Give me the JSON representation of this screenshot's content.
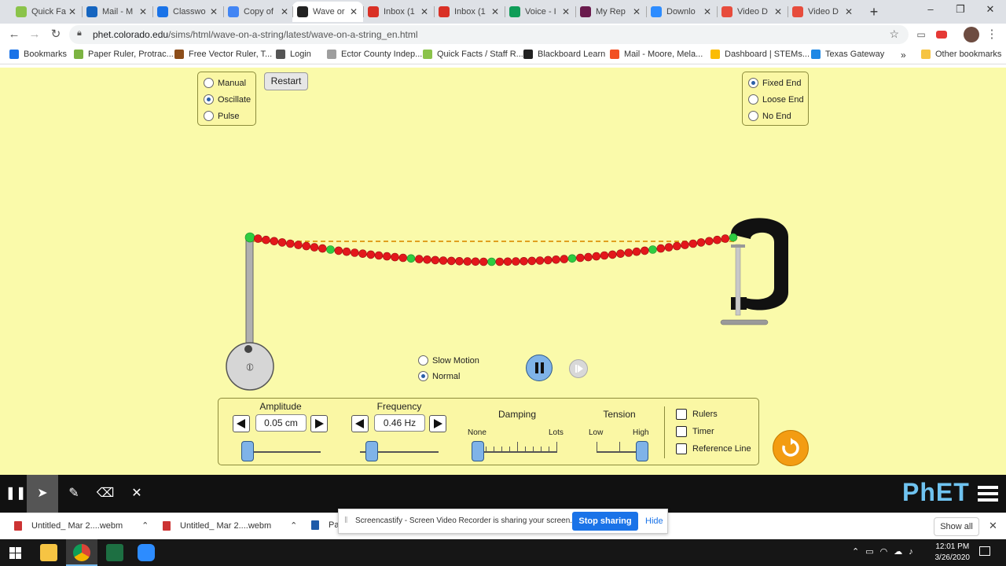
{
  "browser": {
    "tabs": [
      {
        "title": "Quick Fa",
        "color": "#8bc34a"
      },
      {
        "title": "Mail - M",
        "color": "#1565c0"
      },
      {
        "title": "Classwo",
        "color": "#1a73e8"
      },
      {
        "title": "Copy of",
        "color": "#4285f4"
      },
      {
        "title": "Wave or",
        "color": "#222222"
      },
      {
        "title": "Inbox (1",
        "color": "#d93025"
      },
      {
        "title": "Inbox (1",
        "color": "#d93025"
      },
      {
        "title": "Voice - I",
        "color": "#0f9d58"
      },
      {
        "title": "My Rep",
        "color": "#6a1b4d"
      },
      {
        "title": "Downlo",
        "color": "#2d8cff"
      },
      {
        "title": "Video D",
        "color": "#e74c3c"
      },
      {
        "title": "Video D",
        "color": "#e74c3c"
      }
    ],
    "url_host": "phet.colorado.edu",
    "url_path": "/sims/html/wave-on-a-string/latest/wave-on-a-string_en.html",
    "bookmarks": [
      {
        "label": "Bookmarks",
        "color": "#1a73e8"
      },
      {
        "label": "Paper Ruler, Protrac...",
        "color": "#7cb342"
      },
      {
        "label": "Free Vector Ruler, T...",
        "color": "#8d4e1a"
      },
      {
        "label": "Login",
        "color": "#555555"
      },
      {
        "label": "Ector County Indep...",
        "color": "#9e9e9e"
      },
      {
        "label": "Quick Facts / Staff R...",
        "color": "#8bc34a"
      },
      {
        "label": "Blackboard Learn",
        "color": "#222222"
      },
      {
        "label": "Mail - Moore, Mela...",
        "color": "#f25022"
      },
      {
        "label": "Dashboard | STEMs...",
        "color": "#fbbc05"
      },
      {
        "label": "Texas Gateway",
        "color": "#1e88e5"
      }
    ],
    "other_bookmarks": "Other bookmarks",
    "overflow": "»"
  },
  "sim": {
    "mode_options": [
      {
        "label": "Manual",
        "selected": false
      },
      {
        "label": "Oscillate",
        "selected": true
      },
      {
        "label": "Pulse",
        "selected": false
      }
    ],
    "restart_label": "Restart",
    "end_options": [
      {
        "label": "Fixed End",
        "selected": true
      },
      {
        "label": "Loose End",
        "selected": false
      },
      {
        "label": "No End",
        "selected": false
      }
    ],
    "speed_options": [
      {
        "label": "Slow Motion",
        "selected": false
      },
      {
        "label": "Normal",
        "selected": true
      }
    ],
    "amplitude": {
      "label": "Amplitude",
      "value": "0.05 cm",
      "slider_fraction": 0.04
    },
    "frequency": {
      "label": "Frequency",
      "value": "0.46 Hz",
      "slider_fraction": 0.15
    },
    "damping": {
      "label": "Damping",
      "min_label": "None",
      "max_label": "Lots",
      "slider_fraction": 0.0
    },
    "tension": {
      "label": "Tension",
      "min_label": "Low",
      "max_label": "High",
      "slider_fraction": 1.0
    },
    "checkboxes": [
      {
        "label": "Rulers",
        "checked": false
      },
      {
        "label": "Timer",
        "checked": false
      },
      {
        "label": "Reference Line",
        "checked": false
      }
    ],
    "phet_logo": "PhET",
    "colors": {
      "background": "#fafaaa",
      "bead": "#e3171b",
      "bead_marker": "#2ecc40",
      "reference_line": "#e0a020",
      "reset": "#f39c12"
    }
  },
  "screencastify": {
    "share_message": "Screencastify - Screen Video Recorder is sharing your screen.",
    "stop_label": "Stop sharing",
    "hide_label": "Hide"
  },
  "downloads": [
    {
      "name": "Untitled_ Mar 2....webm"
    },
    {
      "name": "Untitled_ Mar 2....webm"
    },
    {
      "name": "Pa"
    }
  ],
  "downloads_show_all": "Show all",
  "taskbar": {
    "time": "12:01 PM",
    "date": "3/26/2020"
  }
}
